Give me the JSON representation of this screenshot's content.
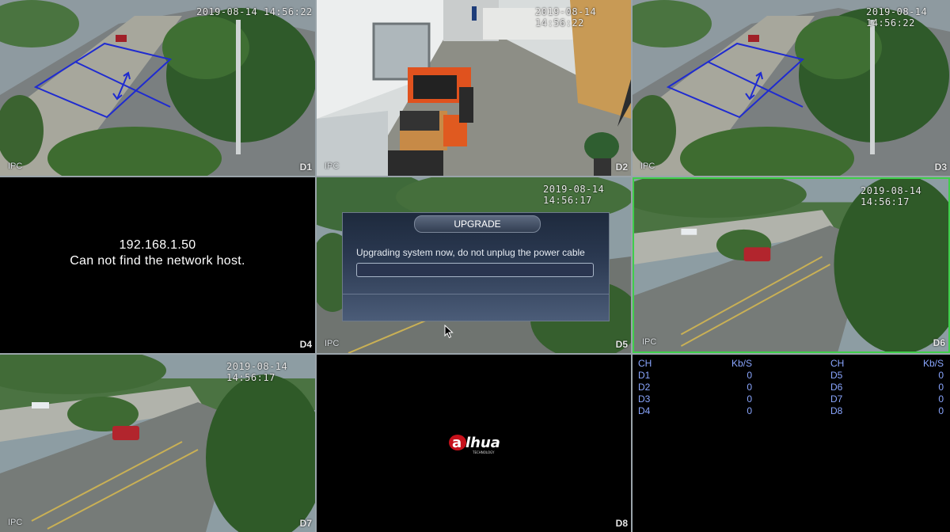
{
  "tiles": [
    {
      "id": "D1",
      "timestamp": "2019-08-14 14:56:22",
      "source": "IPC"
    },
    {
      "id": "D2",
      "timestamp": "2019-08-14 14:56:22",
      "source": "IPC"
    },
    {
      "id": "D3",
      "timestamp": "2019-08-14 14:56:22",
      "source": "IPC"
    },
    {
      "id": "D4",
      "ip": "192.168.1.50",
      "message": "Can not find the network host."
    },
    {
      "id": "D5",
      "timestamp": "2019-08-14 14:56:17",
      "source": "IPC"
    },
    {
      "id": "D6",
      "timestamp": "2019-08-14 14:56:17",
      "source": "IPC"
    },
    {
      "id": "D7",
      "timestamp": "2019-08-14 14:56:17",
      "source": "IPC"
    },
    {
      "id": "D8"
    }
  ],
  "dialog": {
    "title": "UPGRADE",
    "message": "Upgrading system now, do not unplug the power cable",
    "progress": 0
  },
  "bitrate": {
    "headers": [
      "CH",
      "Kb/S",
      "CH",
      "Kb/S"
    ],
    "rows": [
      [
        "D1",
        "0",
        "D5",
        "0"
      ],
      [
        "D2",
        "0",
        "D6",
        "0"
      ],
      [
        "D3",
        "0",
        "D7",
        "0"
      ],
      [
        "D4",
        "0",
        "D8",
        "0"
      ]
    ]
  },
  "logo": {
    "brand": "alhua",
    "tagline": "TECHNOLOGY"
  },
  "colors": {
    "selected_border": "#3fce4b",
    "stats_text": "#8aa6ff",
    "ivs_line": "#1f2bd0"
  }
}
